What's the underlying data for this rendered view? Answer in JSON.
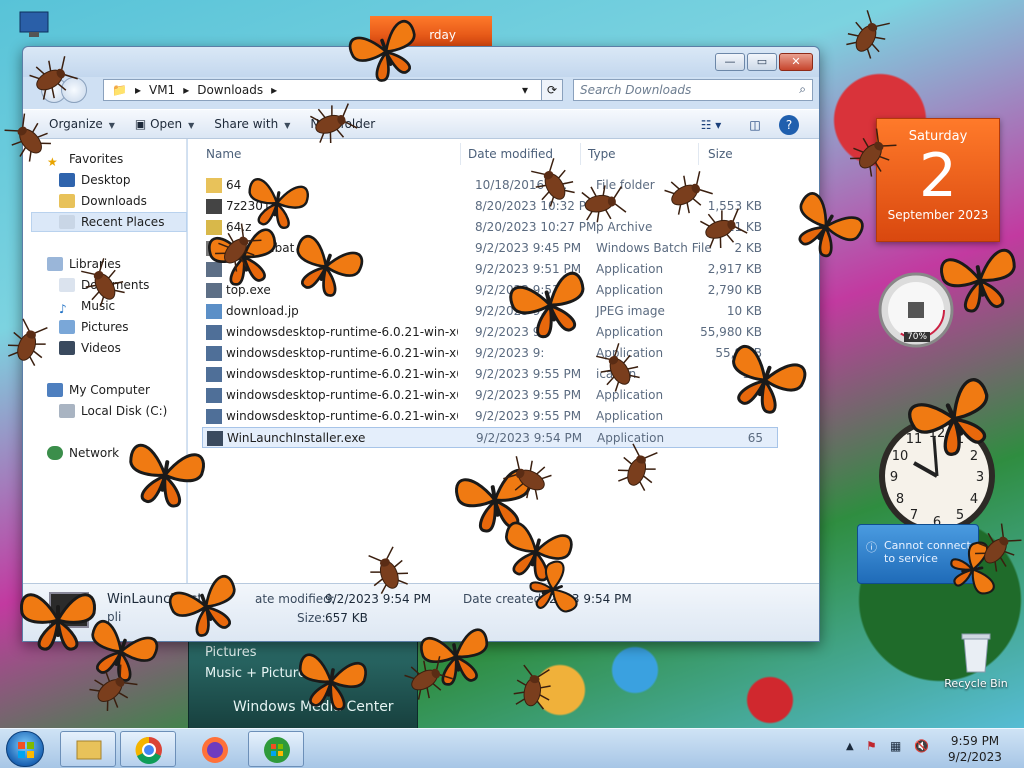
{
  "desktop": {
    "calendar_gadget": {
      "day": "Saturday",
      "date": "2",
      "month_year": "September 2023"
    },
    "calendar_gadget_partial": {
      "label": "rday"
    },
    "cpu_gadget": {
      "percent": "70%"
    },
    "weather_gadget": {
      "message": "Cannot connect to service"
    },
    "recycle_bin": {
      "label": "Recycle Bin"
    },
    "wmc": {
      "line1": "Pictures",
      "line2": "Music + Pictures",
      "title": "Windows Media Center"
    }
  },
  "explorer": {
    "breadcrumb": [
      "VM1",
      "Downloads"
    ],
    "search_placeholder": "Search Downloads",
    "toolbar": {
      "organize": "Organize",
      "open": "Open",
      "share_with": "Share with",
      "new_folder": "New folder"
    },
    "nav": {
      "favorites": "Favorites",
      "desktop": "Desktop",
      "downloads": "Downloads",
      "recent_places": "Recent Places",
      "libraries": "Libraries",
      "documents": "Documents",
      "music": "Music",
      "pictures": "Pictures",
      "videos": "Videos",
      "my_computer": "My Computer",
      "local_disk": "Local Disk (C:)",
      "network": "Network"
    },
    "columns": {
      "name": "Name",
      "date": "Date modified",
      "type": "Type",
      "size": "Size"
    },
    "files": [
      {
        "name": "64",
        "date": "10/18/2016 11:",
        "type": "File folder",
        "size": ""
      },
      {
        "name": "7z2301-",
        "date": "8/20/2023 10:32 PM",
        "type": "",
        "size": "1,553 KB"
      },
      {
        "name": "64.z",
        "date": "8/20/2023 10:27 PM",
        "type": "p Archive",
        "size": "11 KB"
      },
      {
        "name": "ntivirus.bat",
        "date": "9/2/2023 9:45 PM",
        "type": "Windows Batch File",
        "size": "2 KB"
      },
      {
        "name": "",
        "date": "9/2/2023 9:51 PM",
        "type": "Application",
        "size": "2,917 KB"
      },
      {
        "name": "top.exe",
        "date": "9/2/2023 9:53 PM",
        "type": "Application",
        "size": "2,790 KB"
      },
      {
        "name": "download.jp",
        "date": "9/2/2023 9:4",
        "type": "JPEG image",
        "size": "10 KB"
      },
      {
        "name": "windowsdesktop-runtime-6.0.21-win-x64...",
        "date": "9/2/2023 9:",
        "type": "Application",
        "size": "55,980 KB"
      },
      {
        "name": "windowsdesktop-runtime-6.0.21-win-x64...",
        "date": "9/2/2023 9:",
        "type": "Application",
        "size": "55,9 KB"
      },
      {
        "name": "windowsdesktop-runtime-6.0.21-win-x64...",
        "date": "9/2/2023 9:55 PM",
        "type": "ication",
        "size": "55,"
      },
      {
        "name": "windowsdesktop-runtime-6.0.21-win-x64...",
        "date": "9/2/2023 9:55 PM",
        "type": "Application",
        "size": ""
      },
      {
        "name": "windowsdesktop-runtime-6.0.21-win-x64...",
        "date": "9/2/2023 9:55 PM",
        "type": "Application",
        "size": ""
      },
      {
        "name": "WinLaunchInstaller.exe",
        "date": "9/2/2023 9:54 PM",
        "type": "Application",
        "size": "65"
      }
    ],
    "details": {
      "name": "WinLaunchInst",
      "name_suffix": "pli",
      "modified_label": "ate modified:",
      "modified_value": "9/2/2023 9:54 PM",
      "created_label": "Date created:",
      "created_value": "2023 9:54 PM",
      "size_label": "Size:",
      "size_value": "657 KB"
    }
  },
  "taskbar": {
    "time": "9:59 PM",
    "date": "9/2/2023"
  },
  "colors": {
    "monarch_orange": "#f07a12",
    "accent_blue": "#1d65b5",
    "calendar_orange": "#e5591a"
  }
}
